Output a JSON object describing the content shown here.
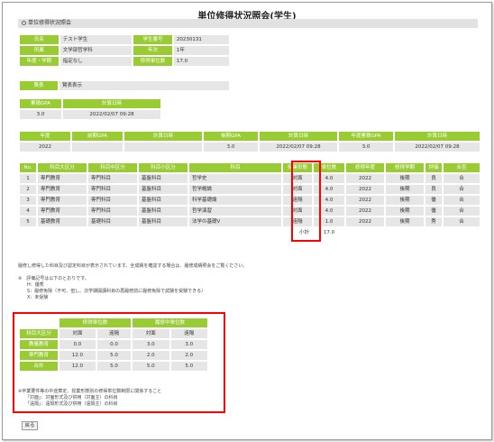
{
  "page": {
    "title": "単位修得状況照会(学生)",
    "section": "単位修得状況照会"
  },
  "student": {
    "name_label": "氏名",
    "name": "テスト学生",
    "id_label": "学生番号",
    "id": "20230131",
    "affil_label": "所属",
    "affil": "文学部哲学科",
    "year_label": "年次",
    "year": "1年",
    "term_label": "年度・学期",
    "term": "指定なし",
    "credits_label": "修得単位数",
    "credits": "17.0"
  },
  "display": {
    "label": "賢表",
    "value": "賢表表示"
  },
  "gpa_total": {
    "h1": "累積GPA",
    "h2": "計算日時",
    "v1": "3.0",
    "v2": "2022/02/07 09:28"
  },
  "gpa_year": {
    "headers": [
      "年度",
      "前期GPA",
      "計算日時",
      "後期GPA",
      "計算日時",
      "年度累積GPA",
      "計算日時"
    ],
    "values": [
      "2022",
      "",
      "",
      "3.0",
      "2022/02/07 09:28",
      "3.0",
      "2022/02/07 09:28"
    ]
  },
  "courses": {
    "headers": [
      "No.",
      "科目大区分",
      "科目中区分",
      "科目小区分",
      "科目",
      "授業形態",
      "単位数",
      "修得年度",
      "修得学期",
      "評価",
      "合否"
    ],
    "rows": [
      [
        "1",
        "専門教育",
        "専門科目",
        "基盤科目",
        "哲学史",
        "対面",
        "4.0",
        "2022",
        "後期",
        "良",
        "合"
      ],
      [
        "2",
        "専門教育",
        "専門科目",
        "基盤科目",
        "哲学概論",
        "対面",
        "4.0",
        "2022",
        "後期",
        "良",
        "合"
      ],
      [
        "3",
        "専門教育",
        "専門科目",
        "基盤科目",
        "科学基礎論",
        "遠隔",
        "4.0",
        "2022",
        "後期",
        "優",
        "合"
      ],
      [
        "4",
        "専門教育",
        "専門科目",
        "基盤科目",
        "哲学演習",
        "対面",
        "4.0",
        "2022",
        "後期",
        "優",
        "合"
      ],
      [
        "5",
        "基礎教育",
        "基礎科目",
        "基盤科目",
        "法学の基礎V",
        "遠隔",
        "1.0",
        "2022",
        "後期",
        "秀",
        "合"
      ]
    ],
    "subtotal_label": "小計",
    "subtotal": "17.0"
  },
  "notes": {
    "n1": "履修し修得した科目及び認定科目が表示されています。全成績を確認する場合は、履修成績照会をご覧ください。",
    "n2": "※　評価記号は以下のとおりです。",
    "n3": "H：優秀",
    "n4": "S：履修免除（不可、但し、次学期開講科目の再履修前に履修免除で試験を受験できる）",
    "n5": "X：未受験"
  },
  "summary": {
    "group_h1": "修得単位数",
    "group_h2": "履修中単位数",
    "col0": "科目大区分",
    "sub": [
      "対面",
      "遠隔",
      "対面",
      "遠隔"
    ],
    "rows": [
      {
        "label": "教養教育",
        "v": [
          "0.0",
          "0.0",
          "3.0",
          "3.0"
        ]
      },
      {
        "label": "専門教育",
        "v": [
          "12.0",
          "5.0",
          "2.0",
          "2.0"
        ]
      },
      {
        "label": "合計",
        "v": [
          "12.0",
          "5.0",
          "5.0",
          "5.0"
        ]
      }
    ],
    "note1": "※卒業要件等の中途算定、授業形態別の修得単位数制限に関係すること",
    "note2": "「対面」：対面形式及び併用（対面主）の科目",
    "note3": "「遠隔」：遠隔形式及び併用（遠隔主）の科目"
  },
  "back_label": "戻る",
  "colors": {
    "accent": "#99cc33",
    "cell": "#e6e6e6",
    "highlight": "#ff0000"
  }
}
